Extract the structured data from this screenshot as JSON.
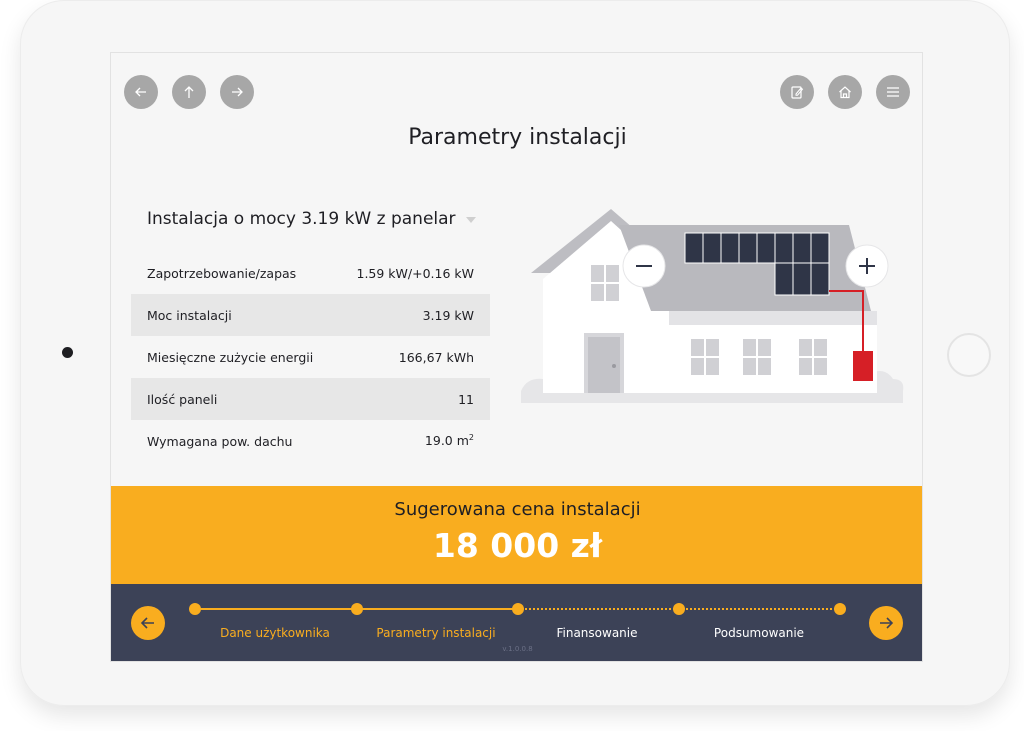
{
  "header": {
    "title": "Parametry instalacji",
    "nav_buttons": [
      "arrow-left",
      "arrow-up",
      "arrow-right"
    ],
    "tool_buttons": [
      "edit",
      "home",
      "menu"
    ]
  },
  "installation": {
    "selected": "Instalacja o mocy 3.19 kW z panelar"
  },
  "params": [
    {
      "label": "Zapotrzebowanie/zapas",
      "value": "1.59 kW/+0.16 kW"
    },
    {
      "label": "Moc instalacji",
      "value": "3.19 kW"
    },
    {
      "label": "Miesięczne zużycie energii",
      "value": "166,67 kWh"
    },
    {
      "label": "Ilość paneli",
      "value": "11"
    },
    {
      "label": "Wymagana pow. dachu",
      "value": "19.0 m",
      "unit_sup": "2"
    }
  ],
  "house": {
    "minus_label": "−",
    "plus_label": "+"
  },
  "price": {
    "label": "Sugerowana cena instalacji",
    "value": "18 000 zł"
  },
  "steps": [
    {
      "label": "Dane użytkownika",
      "done": true
    },
    {
      "label": "Parametry instalacji",
      "done": true
    },
    {
      "label": "Finansowanie",
      "done": false
    },
    {
      "label": "Podsumowanie",
      "done": false
    }
  ],
  "version": "v.1.0.0.8",
  "colors": {
    "accent": "#f9ad1f",
    "nav_bg": "#3c4257",
    "panel": "#2f3547",
    "inverter": "#d61f26"
  }
}
